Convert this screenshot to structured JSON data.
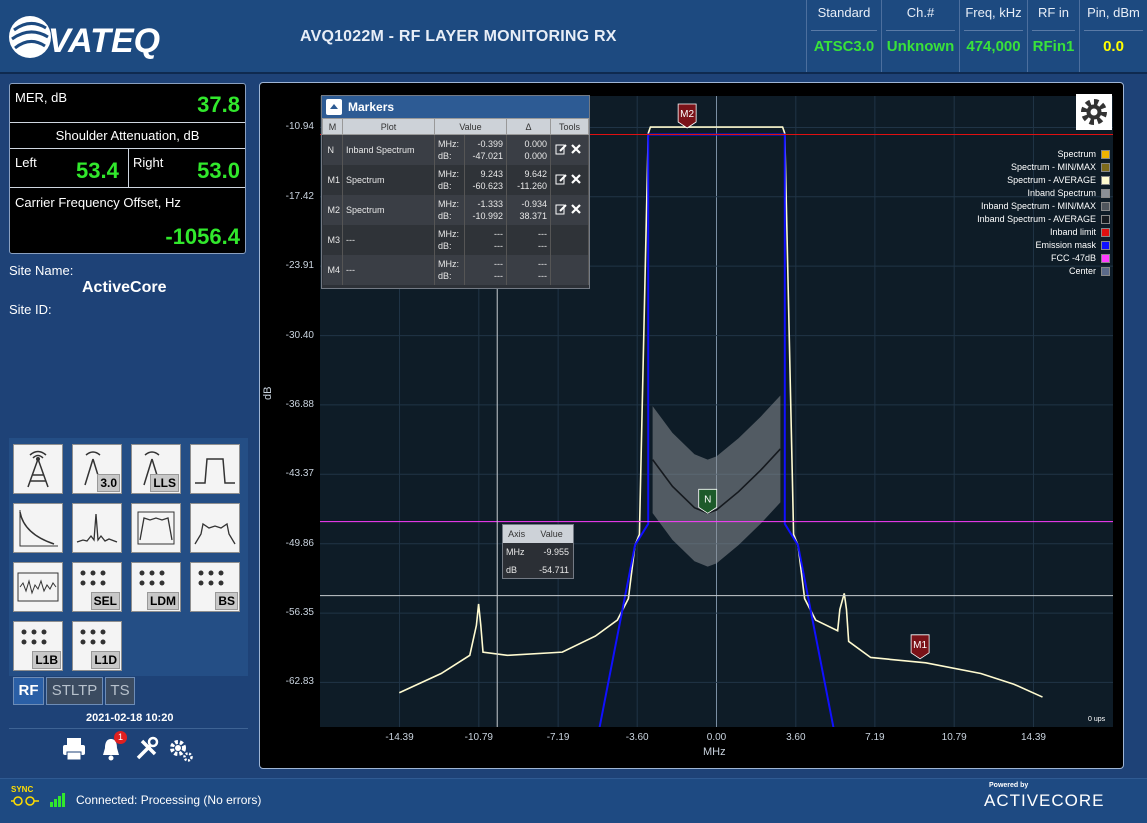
{
  "header": {
    "app_title": "AVQ1022M - RF LAYER MONITORING RX",
    "logo_text": "VATEQ",
    "cells": [
      {
        "label": "Standard",
        "value": "ATSC3.0",
        "value_color": "#39e23a"
      },
      {
        "label": "Ch.#",
        "value": "Unknown",
        "value_color": "#39e23a"
      },
      {
        "label": "Freq, kHz",
        "value": "474,000",
        "value_color": "#39e23a"
      },
      {
        "label": "RF in",
        "value": "RFin1",
        "value_color": "#39e23a"
      },
      {
        "label": "Pin, dBm",
        "value": "0.0",
        "value_color": "#ffff00"
      }
    ]
  },
  "metrics": {
    "mer_label": "MER, dB",
    "mer_value": "37.8",
    "shoulder_label": "Shoulder Attenuation, dB",
    "left_label": "Left",
    "left_value": "53.4",
    "right_label": "Right",
    "right_value": "53.0",
    "cfo_label": "Carrier Frequency Offset, Hz",
    "cfo_value": "-1056.4"
  },
  "site": {
    "name_label": "Site Name:",
    "name_value": "ActiveCore",
    "id_label": "Site ID:"
  },
  "tools": {
    "tags": [
      "3.0",
      "LLS",
      "SEL",
      "LDM",
      "BS",
      "L1B",
      "L1D"
    ]
  },
  "tabs": [
    "RF",
    "STLTP",
    "TS"
  ],
  "datetime": "2021-02-18 10:20",
  "notifications_count": "1",
  "chart": {
    "yticks": [
      "-10.94",
      "-17.42",
      "-23.91",
      "-30.40",
      "-36.88",
      "-43.37",
      "-49.86",
      "-56.35",
      "-62.83"
    ],
    "xticks": [
      "-14.39",
      "-10.79",
      "-7.19",
      "-3.60",
      "0.00",
      "3.60",
      "7.19",
      "10.79",
      "14.39"
    ],
    "ylabel": "dB",
    "xlabel": "MHz",
    "fps": "0 ups",
    "marker_labels": [
      "M2",
      "N",
      "M1"
    ],
    "legend": [
      {
        "label": "Spectrum",
        "color": "#f2b400"
      },
      {
        "label": "Spectrum - MIN/MAX",
        "color": "#7d6a1a"
      },
      {
        "label": "Spectrum - AVERAGE",
        "color": "#fffbd0"
      },
      {
        "label": "Inband Spectrum",
        "color": "#8a8f96"
      },
      {
        "label": "Inband Spectrum - MIN/MAX",
        "color": "#4f555c"
      },
      {
        "label": "Inband Spectrum - AVERAGE",
        "color": "#15191e"
      },
      {
        "label": "Inband limit",
        "color": "#e01010"
      },
      {
        "label": "Emission mask",
        "color": "#1010ff"
      },
      {
        "label": "FCC -47dB",
        "color": "#ff3cff"
      },
      {
        "label": "Center",
        "color": "#5b6a8a"
      }
    ]
  },
  "chart_data": {
    "type": "line",
    "xlabel": "MHz",
    "ylabel": "dB",
    "xlim": [
      -18.0,
      18.0
    ],
    "ylim": [
      -67.0,
      -8.0
    ],
    "yticks": [
      -10.94,
      -17.42,
      -23.91,
      -30.4,
      -36.88,
      -43.37,
      -49.86,
      -56.35,
      -62.83
    ],
    "xticks": [
      -14.39,
      -10.79,
      -7.19,
      -3.6,
      0.0,
      3.6,
      7.19,
      10.79,
      14.39
    ],
    "series": [
      {
        "name": "Spectrum - AVERAGE",
        "color": "#fffbd0",
        "x": [
          -14.4,
          -12.5,
          -11.2,
          -10.9,
          -10.8,
          -10.7,
          -10.6,
          -9.5,
          -7.0,
          -5.5,
          -4.5,
          -4.0,
          -3.7,
          -3.5,
          -3.1,
          -3.0,
          0.0,
          3.0,
          3.1,
          3.5,
          3.7,
          4.0,
          4.5,
          5.5,
          5.6,
          5.8,
          5.9,
          6.0,
          7.0,
          9.5,
          12.0,
          13.5,
          14.8
        ],
        "y": [
          -63.8,
          -62.0,
          -60.3,
          -57.5,
          -55.5,
          -57.5,
          -60.0,
          -60.3,
          -60.0,
          -58.5,
          -57.0,
          -55.0,
          -50.0,
          -49.0,
          -11.5,
          -10.9,
          -10.9,
          -10.9,
          -11.5,
          -49.0,
          -50.0,
          -55.0,
          -57.0,
          -58.0,
          -56.0,
          -54.5,
          -56.0,
          -59.0,
          -60.5,
          -61.0,
          -62.0,
          -63.0,
          -64.2
        ]
      },
      {
        "name": "Inband Spectrum - AVERAGE",
        "color": "#15191e",
        "x": [
          -2.9,
          -2.0,
          -1.0,
          -0.4,
          0.0,
          1.0,
          2.0,
          2.9
        ],
        "y": [
          -42.0,
          -44.5,
          -46.5,
          -47.0,
          -46.7,
          -45.0,
          -43.0,
          -41.0
        ]
      },
      {
        "name": "Emission mask",
        "color": "#1010ff",
        "x": [
          -5.4,
          -3.7,
          -3.1,
          -3.1,
          3.1,
          3.1,
          3.7,
          5.4
        ],
        "y": [
          -68.0,
          -50.0,
          -48.0,
          -11.6,
          -11.6,
          -48.0,
          -50.0,
          -68.0
        ]
      },
      {
        "name": "Inband limit",
        "color": "#e01010",
        "x": [
          -18.0,
          18.0
        ],
        "y": [
          -11.6,
          -11.6
        ]
      },
      {
        "name": "FCC -47dB",
        "color": "#ff3cff",
        "x": [
          -18.0,
          18.0
        ],
        "y": [
          -47.8,
          -47.8
        ]
      }
    ],
    "cursor": {
      "x": -9.955,
      "y": -54.711
    },
    "markers": [
      {
        "name": "N",
        "x": -0.399,
        "y": -47.021
      },
      {
        "name": "M1",
        "x": 9.243,
        "y": -60.623
      },
      {
        "name": "M2",
        "x": -1.333,
        "y": -10.992
      }
    ],
    "legend_position": "top-right",
    "grid": true
  },
  "markers_table": {
    "title": "Markers",
    "headers": [
      "M",
      "Plot",
      "Value",
      "Δ",
      "Tools"
    ],
    "rows": [
      {
        "m": "N",
        "plot": "Inband Spectrum",
        "units": [
          "MHz:",
          "dB:"
        ],
        "value": [
          "-0.399",
          "-47.021"
        ],
        "delta": [
          "0.000",
          "0.000"
        ],
        "tools": true
      },
      {
        "m": "M1",
        "plot": "Spectrum",
        "units": [
          "MHz:",
          "dB:"
        ],
        "value": [
          "9.243",
          "-60.623"
        ],
        "delta": [
          "9.642",
          "-11.260"
        ],
        "tools": true
      },
      {
        "m": "M2",
        "plot": "Spectrum",
        "units": [
          "MHz:",
          "dB:"
        ],
        "value": [
          "-1.333",
          "-10.992"
        ],
        "delta": [
          "-0.934",
          "38.371"
        ],
        "tools": true
      },
      {
        "m": "M3",
        "plot": "---",
        "units": [
          "MHz:",
          "dB:"
        ],
        "value": [
          "---",
          "---"
        ],
        "delta": [
          "---",
          "---"
        ],
        "tools": false
      },
      {
        "m": "M4",
        "plot": "---",
        "units": [
          "MHz:",
          "dB:"
        ],
        "value": [
          "---",
          "---"
        ],
        "delta": [
          "---",
          "---"
        ],
        "tools": false
      }
    ]
  },
  "axis_readout": {
    "headers": [
      "Axis",
      "Value"
    ],
    "rows": [
      {
        "axis": "MHz",
        "value": "-9.955"
      },
      {
        "axis": "dB",
        "value": "-54.711"
      }
    ]
  },
  "status": {
    "sync_label": "SYNC",
    "text": "Connected: Processing (No errors)",
    "powered_by": "Powered by",
    "brand": "ACTIVECORE"
  }
}
